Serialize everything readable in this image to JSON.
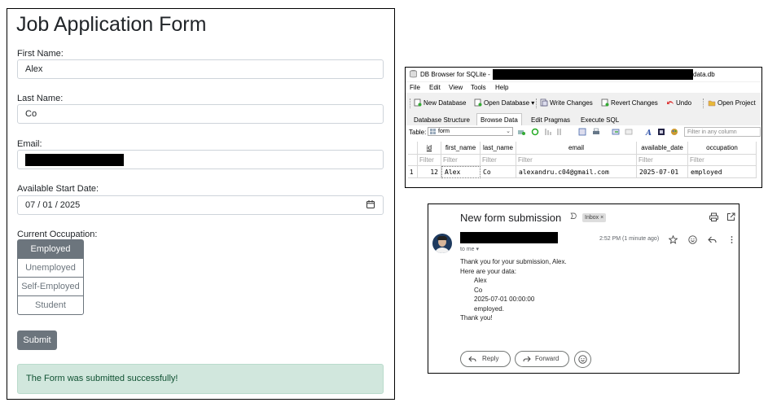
{
  "form": {
    "title": "Job Application Form",
    "first_name_label": "First Name:",
    "first_name_value": "Alex",
    "last_name_label": "Last Name:",
    "last_name_value": "Co",
    "email_label": "Email:",
    "date_label": "Available Start Date:",
    "date_value": "07 / 01 / 2025",
    "occupation_label": "Current Occupation:",
    "occupations": [
      "Employed",
      "Unemployed",
      "Self-Employed",
      "Student"
    ],
    "selected_occupation": "Employed",
    "submit_label": "Submit",
    "success_message": "The Form was submitted successfully!"
  },
  "db": {
    "title_prefix": "DB Browser for SQLite -",
    "title_suffix": "data.db",
    "menu": [
      "File",
      "Edit",
      "View",
      "Tools",
      "Help"
    ],
    "toolbar": [
      "New Database",
      "Open Database",
      "Write Changes",
      "Revert Changes",
      "Undo",
      "Open Project"
    ],
    "tabs": [
      "Database Structure",
      "Browse Data",
      "Edit Pragmas",
      "Execute SQL"
    ],
    "active_tab": "Browse Data",
    "table_label": "Table:",
    "table_name": "form",
    "filter_any_placeholder": "Filter in any column",
    "columns": [
      "id",
      "first_name",
      "last_name",
      "email",
      "available_date",
      "occupation"
    ],
    "filter_placeholder": "Filter",
    "row_number": "1",
    "row": [
      "12",
      "Alex",
      "Co",
      "alexandru.c04@gmail.com",
      "2025-07-01",
      "employed"
    ]
  },
  "mail": {
    "subject": "New form submission",
    "label": "Inbox",
    "label_close": "×",
    "to": "to me",
    "time": "2:52 PM (1 minute ago)",
    "body": {
      "greeting": "Thank you for your submission, Alex.",
      "intro": "Here are your data:",
      "values": [
        "Alex",
        "Co",
        "2025-07-01 00:00:00",
        "employed."
      ],
      "closing": "Thank you!"
    },
    "reply_label": "Reply",
    "forward_label": "Forward"
  },
  "colors": {
    "secondary": "#6c757d",
    "success_bg": "#d1e7dd",
    "success_text": "#0f5132",
    "redaction": "#000000"
  }
}
